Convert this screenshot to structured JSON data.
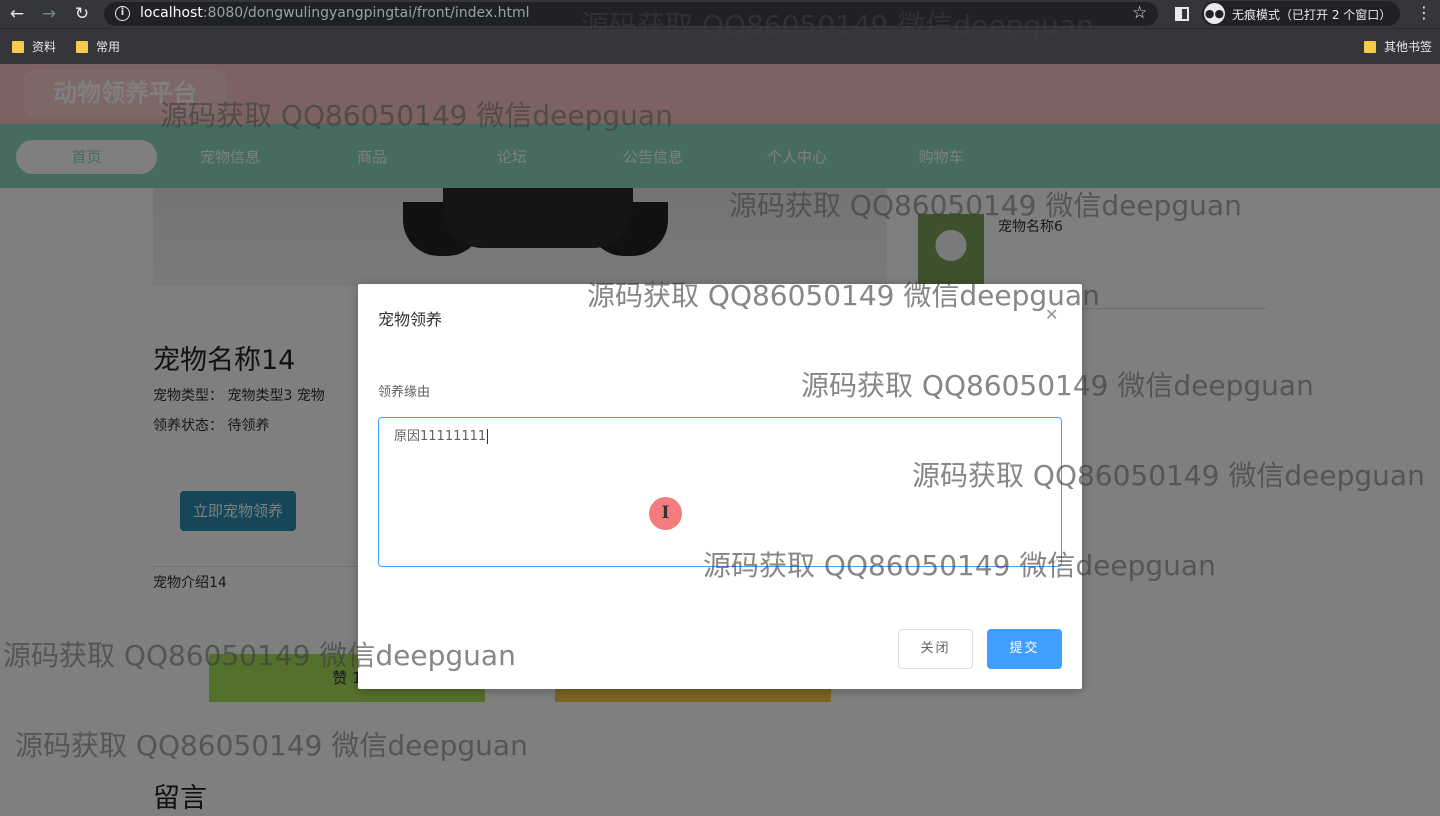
{
  "browser": {
    "back_icon": "arrow-left-icon",
    "forward_icon": "arrow-right-icon",
    "reload_icon": "reload-icon",
    "url_host": "localhost",
    "url_rest": ":8080/dongwulingyangpingtai/front/index.html",
    "incognito_label": "无痕模式（已打开 2 个窗口）",
    "bookmarks": [
      "资料",
      "常用"
    ],
    "other_bookmarks": "其他书签"
  },
  "site": {
    "logo": "动物领养平台",
    "nav": [
      "首页",
      "宠物信息",
      "商品",
      "论坛",
      "公告信息",
      "个人中心",
      "购物车"
    ],
    "active_nav": "首页"
  },
  "detail": {
    "title": "宠物名称14",
    "type_row": "宠物类型：  宠物类型3    宠物",
    "status_row": "领养状态：  待领养",
    "adopt_button": "立即宠物领养",
    "intro": "宠物介绍14",
    "like_button": "赞  1",
    "comment_title": "留言",
    "side_item_name": "宠物名称6"
  },
  "dialog": {
    "title": "宠物领养",
    "field_label": "领养缘由",
    "textarea_value": "原因11111111",
    "close_button": "关闭",
    "submit_button": "提交",
    "accent_color": "#409eff"
  },
  "watermark": "源码获取 QQ86050149 微信deepguan"
}
